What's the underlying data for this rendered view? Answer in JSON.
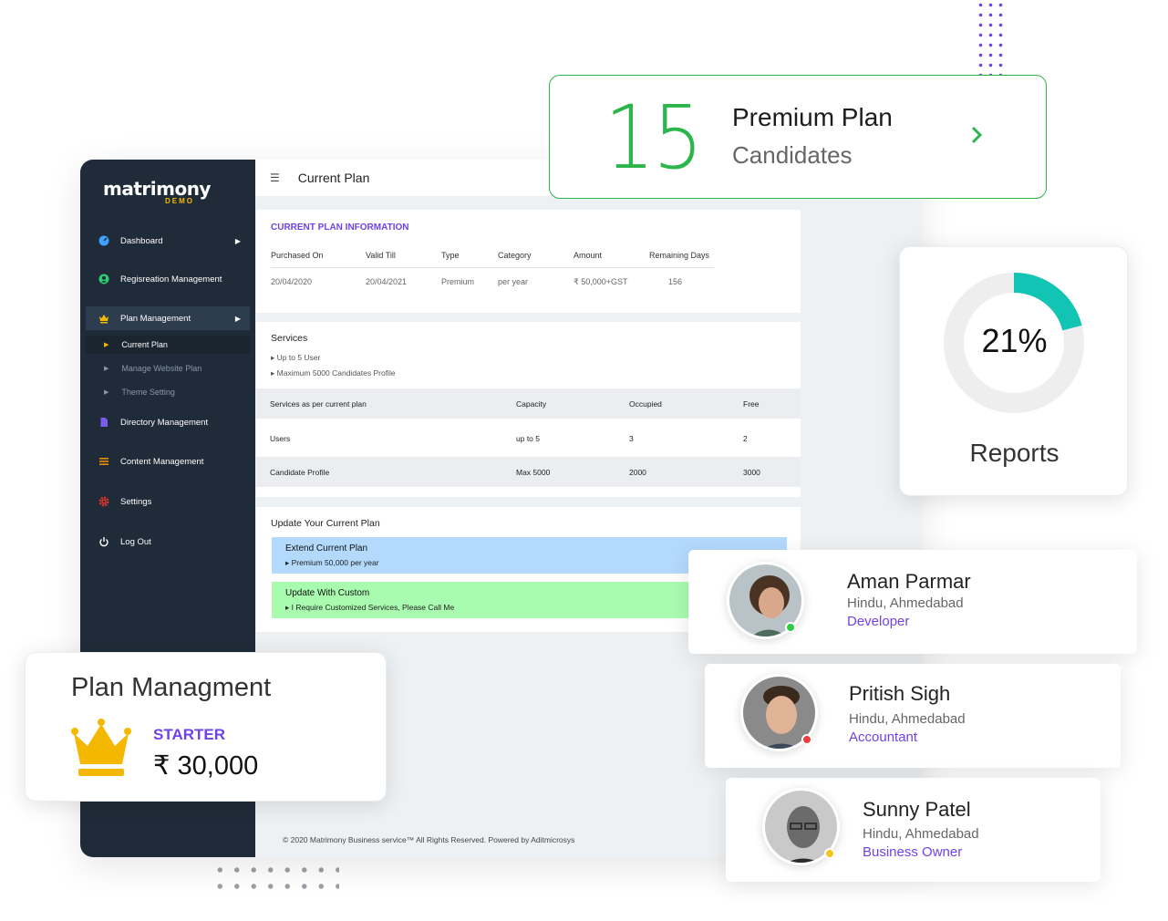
{
  "app": {
    "logo": {
      "main": "matrimony",
      "sub": "DEMO"
    },
    "sidebar": {
      "items": [
        {
          "label": "Dashboard",
          "icon": "dashboard-icon"
        },
        {
          "label": "Regisreation Management",
          "icon": "user-circle-icon"
        },
        {
          "label": "Plan Management",
          "icon": "crown-icon"
        },
        {
          "label": "Directory Management",
          "icon": "document-icon"
        },
        {
          "label": "Content Management",
          "icon": "list-icon"
        },
        {
          "label": "Settings",
          "icon": "gear-icon"
        },
        {
          "label": "Log Out",
          "icon": "power-icon"
        }
      ],
      "plan_subitems": [
        "Current Plan",
        "Manage Website Plan",
        "Theme Setting"
      ]
    },
    "topbar": {
      "title": "Current Plan"
    },
    "current_plan": {
      "heading": "CURRENT PLAN INFORMATION",
      "columns": [
        "Purchased On",
        "Valid Till",
        "Type",
        "Category",
        "Amount",
        "Remaining Days"
      ],
      "values": [
        "20/04/2020",
        "20/04/2021",
        "Premium",
        "per year",
        "₹ 50,000+GST",
        "156"
      ]
    },
    "services": {
      "title": "Services",
      "list": [
        "Up to 5 User",
        "Maximum 5000 Candidates Profile"
      ],
      "table": {
        "headers": [
          "Services as per current plan",
          "Capacity",
          "Occupied",
          "Free"
        ],
        "rows": [
          [
            "Users",
            "up to 5",
            "3",
            "2"
          ],
          [
            "Candidate Profile",
            "Max 5000",
            "2000",
            "3000"
          ]
        ]
      }
    },
    "update": {
      "title": "Update Your Current Plan",
      "options": [
        {
          "title": "Extend Current Plan",
          "sub": "Premium 50,000 per year"
        },
        {
          "title": "Update With Custom",
          "sub": "I Require Customized Services, Please Call Me"
        }
      ]
    },
    "footer": "© 2020 Matrimony Business service™ All Rights Reserved. Powered by Aditmicrosys"
  },
  "premium_card": {
    "number": "15",
    "line1": "Premium Plan",
    "line2": "Candidates"
  },
  "reports_card": {
    "percent_label": "21%",
    "percent": 21,
    "label": "Reports",
    "accent": "#12c4b4"
  },
  "plan_card": {
    "title": "Plan Managment",
    "tier": "STARTER",
    "price": "₹ 30,000"
  },
  "people": [
    {
      "name": "Aman Parmar",
      "location": "Hindu, Ahmedabad",
      "role": "Developer",
      "status_color": "#2ecc40"
    },
    {
      "name": "Pritish Sigh",
      "location": "Hindu, Ahmedabad",
      "role": "Accountant",
      "status_color": "#f03e3e"
    },
    {
      "name": "Sunny Patel",
      "location": "Hindu, Ahmedabad",
      "role": "Business Owner",
      "status_color": "#f5c518"
    }
  ],
  "colors": {
    "accent_purple": "#6f42e8",
    "accent_green": "#2ab64a",
    "sidebar_bg": "#1f2b38",
    "crown": "#f5b800"
  }
}
